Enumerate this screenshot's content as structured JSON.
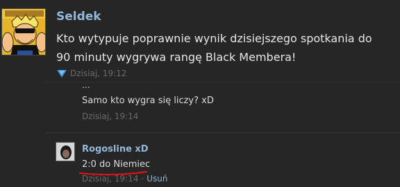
{
  "post": {
    "author": "Seldek",
    "text": "Kto wytypuje poprawnie wynik dzisiejszego spotkania do 90 minuty wygrywa rangę Black Membera!",
    "timestamp": "Dzisiaj, 19:12",
    "like_icon": "like-icon"
  },
  "comments": {
    "cut_line": "...",
    "items": [
      {
        "text": "Samo kto wygra się liczy? xD",
        "timestamp": "Dzisiaj, 19:14"
      },
      {
        "author": "Rogosline xD",
        "text": "2:0 do Niemiec",
        "timestamp": "Dzisiaj, 19:14",
        "separator": "·",
        "delete_label": "Usuń",
        "annotation_color": "#e0101a"
      }
    ]
  },
  "colors": {
    "background": "#262626",
    "author_link": "#93b8d6",
    "text": "#e6e6e6",
    "muted": "#6a6a6a"
  }
}
